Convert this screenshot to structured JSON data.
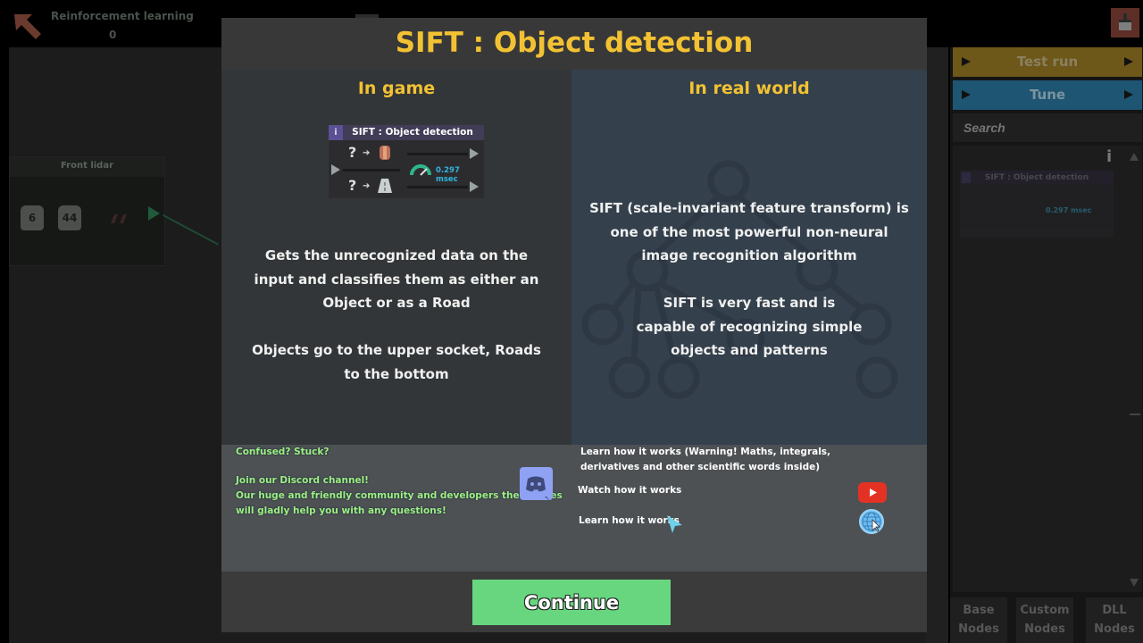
{
  "header": {
    "level_title": "Reinforcement learning",
    "score": "0",
    "back_icon": "back-arrow-icon",
    "cleanup_icon": "brush-icon"
  },
  "canvas": {
    "lidar_node": {
      "title": "Front lidar",
      "chips": [
        "6",
        "44"
      ]
    }
  },
  "sidebar": {
    "test_run_label": "Test run",
    "tune_label": "Tune",
    "search_placeholder": "Search",
    "info_label": "i",
    "node_preview_title": "SIFT : Object detection",
    "node_preview_speed": "0.297 msec",
    "tabs": [
      {
        "line1": "Base",
        "line2": "Nodes"
      },
      {
        "line1": "Custom",
        "line2": "Nodes"
      },
      {
        "line1": "DLL",
        "line2": "Nodes"
      }
    ]
  },
  "modal": {
    "title": "SIFT : Object detection",
    "in_game": {
      "heading": "In game",
      "node": {
        "info_label": "i",
        "title": "SIFT : Object detection",
        "question_mark": "?",
        "arrow": "➔",
        "speed": "0.297 msec"
      },
      "paragraph1": "Gets the unrecognized data on the input and classifies them as either an Object or as a Road",
      "paragraph2": "Objects go to the upper socket, Roads to the bottom"
    },
    "real_world": {
      "heading": "In real world",
      "paragraph1": "SIFT (scale-invariant feature transform) is one of the most powerful non-neural image recognition algorithm",
      "paragraph2": "SIFT is very fast and is capable of recognizing simple objects and patterns"
    },
    "help_left": {
      "line1": "Confused? Stuck?",
      "line2": "Join our Discord channel!",
      "line3": "Our huge and friendly community and developers themselves",
      "line4": "will gladly help you with any questions!",
      "icon": "discord-icon"
    },
    "help_right": {
      "intro_line1": "Learn how it works (Warning! Maths, integrals,",
      "intro_line2": "derivatives and other scientific words inside)",
      "watch_label": "Watch how it works",
      "watch_icon": "youtube-icon",
      "learn_label": "Learn how it works",
      "learn_icon": "globe-icon"
    },
    "continue_label": "Continue"
  },
  "colors": {
    "title_yellow": "#f2c233",
    "continue_green": "#67d67f",
    "help_green_text": "#9ff082",
    "speed_blue": "#2fb5df"
  }
}
